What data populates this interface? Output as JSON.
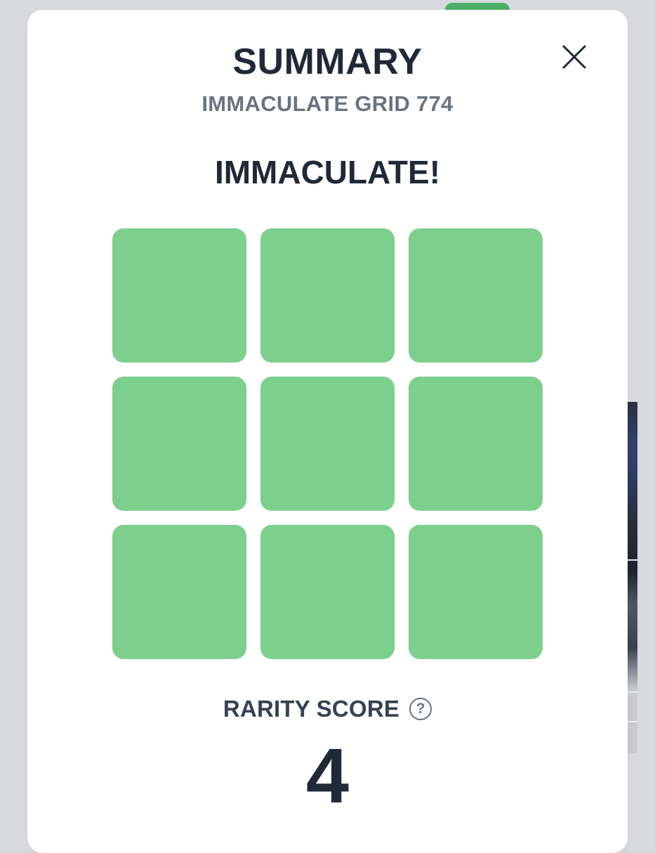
{
  "summary": {
    "title": "SUMMARY",
    "subtitle": "IMMACULATE GRID 774",
    "result_label": "IMMACULATE!",
    "grid_cells": [
      {
        "state": "correct"
      },
      {
        "state": "correct"
      },
      {
        "state": "correct"
      },
      {
        "state": "correct"
      },
      {
        "state": "correct"
      },
      {
        "state": "correct"
      },
      {
        "state": "correct"
      },
      {
        "state": "correct"
      },
      {
        "state": "correct"
      }
    ],
    "rarity_label": "RARITY SCORE",
    "rarity_help_glyph": "?",
    "rarity_value": "4"
  },
  "icons": {
    "close": "close-icon",
    "help": "help-icon"
  },
  "colors": {
    "correct_cell": "#7dcf8d",
    "title_text": "#1f2937",
    "subtitle_text": "#6b7280",
    "modal_bg": "#ffffff",
    "backdrop": "#d9dade"
  }
}
